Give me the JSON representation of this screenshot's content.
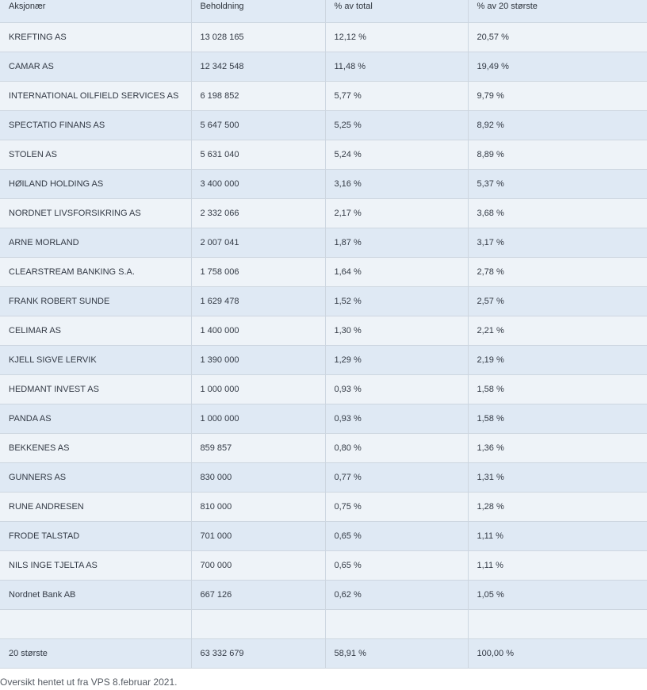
{
  "table": {
    "headers": [
      "Aksjonær",
      "Beholdning",
      "% av total",
      "% av 20 største"
    ],
    "rows": [
      [
        "KREFTING AS",
        "13 028 165",
        "12,12 %",
        "20,57 %"
      ],
      [
        "CAMAR AS",
        "12 342 548",
        "11,48 %",
        "19,49 %"
      ],
      [
        "INTERNATIONAL OILFIELD SERVICES AS",
        "6 198 852",
        "5,77 %",
        "9,79 %"
      ],
      [
        "SPECTATIO FINANS AS",
        "5 647 500",
        "5,25 %",
        "8,92 %"
      ],
      [
        "STOLEN AS",
        "5 631 040",
        "5,24 %",
        "8,89 %"
      ],
      [
        "HØILAND HOLDING AS",
        "3 400 000",
        "3,16 %",
        "5,37 %"
      ],
      [
        "NORDNET LIVSFORSIKRING AS",
        "2 332 066",
        "2,17 %",
        "3,68 %"
      ],
      [
        "ARNE MORLAND",
        "2 007 041",
        "1,87 %",
        "3,17 %"
      ],
      [
        "CLEARSTREAM BANKING S.A.",
        "1 758 006",
        "1,64 %",
        "2,78 %"
      ],
      [
        "FRANK ROBERT SUNDE",
        "1 629 478",
        "1,52 %",
        "2,57 %"
      ],
      [
        "CELIMAR AS",
        "1 400 000",
        "1,30 %",
        "2,21 %"
      ],
      [
        "KJELL SIGVE LERVIK",
        "1 390 000",
        "1,29 %",
        "2,19 %"
      ],
      [
        "HEDMANT INVEST AS",
        "1 000 000",
        "0,93 %",
        "1,58 %"
      ],
      [
        "PANDA AS",
        "1 000 000",
        "0,93 %",
        "1,58 %"
      ],
      [
        "BEKKENES AS",
        "859 857",
        "0,80 %",
        "1,36 %"
      ],
      [
        "GUNNERS AS",
        "830 000",
        "0,77 %",
        "1,31 %"
      ],
      [
        "RUNE ANDRESEN",
        "810 000",
        "0,75 %",
        "1,28 %"
      ],
      [
        "FRODE TALSTAD",
        "701 000",
        "0,65 %",
        "1,11 %"
      ],
      [
        "NILS INGE TJELTA AS",
        "700 000",
        "0,65 %",
        "1,11 %"
      ],
      [
        "Nordnet Bank AB",
        "667 126",
        "0,62 %",
        "1,05 %"
      ],
      [
        "",
        "",
        "",
        ""
      ],
      [
        "20 største",
        "63 332 679",
        "58,91 %",
        "100,00 %"
      ]
    ]
  },
  "footnote": "Oversikt hentet ut fra VPS 8.februar 2021."
}
